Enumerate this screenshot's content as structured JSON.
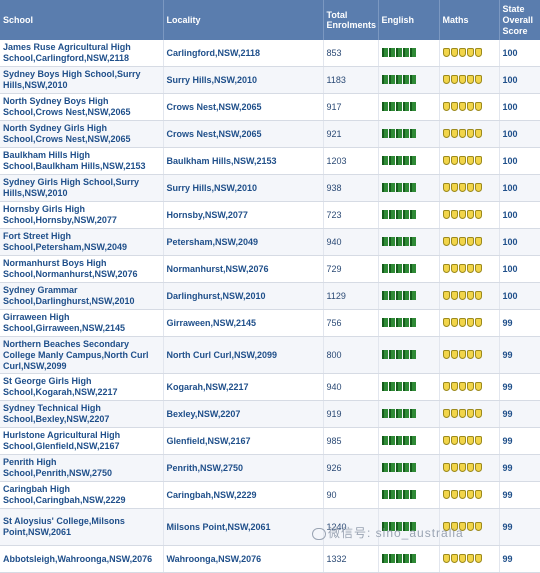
{
  "headers": {
    "school": "School",
    "locality": "Locality",
    "enrolments": "Total Enrolments",
    "english": "English",
    "maths": "Maths",
    "score": "State Overall Score"
  },
  "rows": [
    {
      "school": "James Ruse Agricultural High School,Carlingford,NSW,2118",
      "locality": "Carlingford,NSW,2118",
      "enrolments": "853",
      "score": "100",
      "english_rating": 5,
      "maths_rating": 5
    },
    {
      "school": "Sydney Boys High School,Surry Hills,NSW,2010",
      "locality": "Surry Hills,NSW,2010",
      "enrolments": "1183",
      "score": "100",
      "english_rating": 5,
      "maths_rating": 5
    },
    {
      "school": "North Sydney Boys High School,Crows Nest,NSW,2065",
      "locality": "Crows Nest,NSW,2065",
      "enrolments": "917",
      "score": "100",
      "english_rating": 5,
      "maths_rating": 5
    },
    {
      "school": "North Sydney Girls High School,Crows Nest,NSW,2065",
      "locality": "Crows Nest,NSW,2065",
      "enrolments": "921",
      "score": "100",
      "english_rating": 5,
      "maths_rating": 5
    },
    {
      "school": "Baulkham Hills High School,Baulkham Hills,NSW,2153",
      "locality": "Baulkham Hills,NSW,2153",
      "enrolments": "1203",
      "score": "100",
      "english_rating": 5,
      "maths_rating": 5
    },
    {
      "school": "Sydney Girls High School,Surry Hills,NSW,2010",
      "locality": "Surry Hills,NSW,2010",
      "enrolments": "938",
      "score": "100",
      "english_rating": 5,
      "maths_rating": 5
    },
    {
      "school": "Hornsby Girls High School,Hornsby,NSW,2077",
      "locality": "Hornsby,NSW,2077",
      "enrolments": "723",
      "score": "100",
      "english_rating": 5,
      "maths_rating": 5
    },
    {
      "school": "Fort Street High School,Petersham,NSW,2049",
      "locality": "Petersham,NSW,2049",
      "enrolments": "940",
      "score": "100",
      "english_rating": 5,
      "maths_rating": 5
    },
    {
      "school": "Normanhurst Boys High School,Normanhurst,NSW,2076",
      "locality": "Normanhurst,NSW,2076",
      "enrolments": "729",
      "score": "100",
      "english_rating": 5,
      "maths_rating": 5
    },
    {
      "school": "Sydney Grammar School,Darlinghurst,NSW,2010",
      "locality": "Darlinghurst,NSW,2010",
      "enrolments": "1129",
      "score": "100",
      "english_rating": 5,
      "maths_rating": 5
    },
    {
      "school": "Girraween High School,Girraween,NSW,2145",
      "locality": "Girraween,NSW,2145",
      "enrolments": "756",
      "score": "99",
      "english_rating": 5,
      "maths_rating": 5
    },
    {
      "school": "Northern Beaches Secondary College Manly Campus,North Curl Curl,NSW,2099",
      "locality": "North Curl Curl,NSW,2099",
      "enrolments": "800",
      "score": "99",
      "english_rating": 5,
      "maths_rating": 5
    },
    {
      "school": "St George Girls High School,Kogarah,NSW,2217",
      "locality": "Kogarah,NSW,2217",
      "enrolments": "940",
      "score": "99",
      "english_rating": 5,
      "maths_rating": 5
    },
    {
      "school": "Sydney Technical High School,Bexley,NSW,2207",
      "locality": "Bexley,NSW,2207",
      "enrolments": "919",
      "score": "99",
      "english_rating": 5,
      "maths_rating": 5
    },
    {
      "school": "Hurlstone Agricultural High School,Glenfield,NSW,2167",
      "locality": "Glenfield,NSW,2167",
      "enrolments": "985",
      "score": "99",
      "english_rating": 5,
      "maths_rating": 5
    },
    {
      "school": "Penrith High School,Penrith,NSW,2750",
      "locality": "Penrith,NSW,2750",
      "enrolments": "926",
      "score": "99",
      "english_rating": 5,
      "maths_rating": 5
    },
    {
      "school": "Caringbah High School,Caringbah,NSW,2229",
      "locality": "Caringbah,NSW,2229",
      "enrolments": "90",
      "score": "99",
      "english_rating": 5,
      "maths_rating": 5
    },
    {
      "school": "St Aloysius' College,Milsons Point,NSW,2061",
      "locality": "Milsons Point,NSW,2061",
      "enrolments": "1240",
      "score": "99",
      "english_rating": 5,
      "maths_rating": 5
    },
    {
      "school": "Abbotsleigh,Wahroonga,NSW,2076",
      "locality": "Wahroonga,NSW,2076",
      "enrolments": "1332",
      "score": "99",
      "english_rating": 5,
      "maths_rating": 5
    }
  ],
  "icons": {
    "english": "book-icon",
    "maths": "apple-icon"
  },
  "colors": {
    "header_bg": "#5a7dae",
    "link_text": "#1f4f8a",
    "book": "#2f8a36",
    "apple": "#f2d54a"
  },
  "watermark": {
    "text": "微信号: sino_australia"
  }
}
